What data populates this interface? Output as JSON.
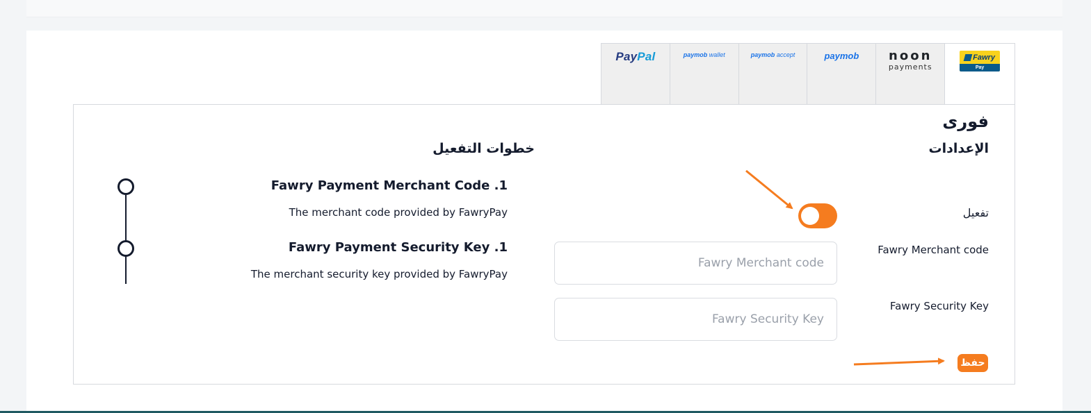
{
  "tabs": [
    {
      "name": "PayPal",
      "logo_text": "PayPal",
      "logo_text_a": "Pay",
      "logo_text_b": "Pal",
      "active": false
    },
    {
      "name": "paymob wallet",
      "logo_text_a": "paymob",
      "logo_text_b": " wallet",
      "active": false
    },
    {
      "name": "paymob accept",
      "logo_text_a": "paymob",
      "logo_text_b": " accept",
      "active": false
    },
    {
      "name": "paymob",
      "logo_text": "paymob",
      "active": false
    },
    {
      "name": "noon payments",
      "logo_text_a": "noon",
      "logo_text_b": "payments",
      "active": false
    },
    {
      "name": "Fawry Pay",
      "logo_text_a": "Fawry",
      "logo_text_b": "Pay",
      "active": true
    }
  ],
  "panel": {
    "title": "فورى",
    "settings_heading": "الإعدادات",
    "steps_heading": "خطوات التفعيل",
    "activate_label": "تفعيل",
    "activate_enabled": true,
    "merchant_label": "Fawry Merchant code",
    "merchant_placeholder": "Fawry Merchant code",
    "merchant_value": "",
    "security_label": "Fawry Security Key",
    "security_placeholder": "Fawry Security Key",
    "security_value": "",
    "save_label": "حفظ"
  },
  "steps": [
    {
      "title": "Fawry Payment Merchant Code .1",
      "desc": "The merchant code provided by FawryPay"
    },
    {
      "title": "Fawry Payment Security Key .1",
      "desc": "The merchant security key provided by FawryPay"
    }
  ],
  "colors": {
    "accent": "#f57c1f",
    "text": "#141b2d",
    "tab_bg": "#efefef",
    "border": "#d6d9de",
    "paypal_dark": "#253b80",
    "paypal_light": "#179bd7",
    "paymob_blue": "#1a73e8",
    "fawry_yellow": "#f9d21d",
    "fawry_blue": "#0b5a8a"
  }
}
